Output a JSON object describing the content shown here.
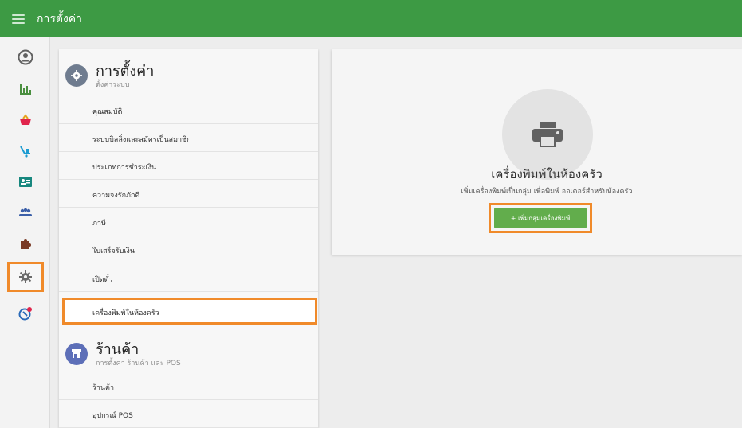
{
  "topbar": {
    "title": "การตั้งค่า"
  },
  "settings": {
    "title": "การตั้งค่า",
    "subtitle": "ตั้งค่าระบบ",
    "items": [
      {
        "label": "คุณสมบัติ"
      },
      {
        "label": "ระบบบิลลิ่งและสมัครเป็นสมาชิก"
      },
      {
        "label": "ประเภทการชำระเงิน"
      },
      {
        "label": "ความจงรักภักดี"
      },
      {
        "label": "ภาษี"
      },
      {
        "label": "ใบเสร็จรับเงิน"
      },
      {
        "label": "เปิดตั๋ว"
      },
      {
        "label": "เครื่องพิมพ์ในห้องครัว"
      }
    ]
  },
  "store": {
    "title": "ร้านค้า",
    "subtitle": "การตั้งค่า ร้านค้า และ POS",
    "items": [
      {
        "label": "ร้านค้า"
      },
      {
        "label": "อุปกรณ์ POS"
      }
    ]
  },
  "kitchen_card": {
    "title": "เครื่องพิมพ์ในห้องครัว",
    "description": "เพิ่มเครื่องพิมพ์เป็นกลุ่ม เพื่อพิมพ์ ออเดอร์สำหรับห้องครัว",
    "button_label": "+ เพิ่มกลุ่มเครื่องพิมพ์"
  },
  "colors": {
    "topbar": "#3d9a44",
    "accent_orange": "#f08a2a",
    "button_green": "#62ad4c",
    "settings_icon_bg": "#6f7c8f",
    "store_icon_bg": "#5d6fb8"
  },
  "icons": {
    "menu": "hamburger-icon",
    "nav": [
      "account-icon",
      "reports-icon",
      "items-icon",
      "employees-icon",
      "customers-icon",
      "integrations-icon",
      "apps-icon",
      "settings-icon",
      "help-icon"
    ],
    "settings_section": "gear-icon",
    "store_section": "store-icon",
    "card": "printer-icon"
  }
}
